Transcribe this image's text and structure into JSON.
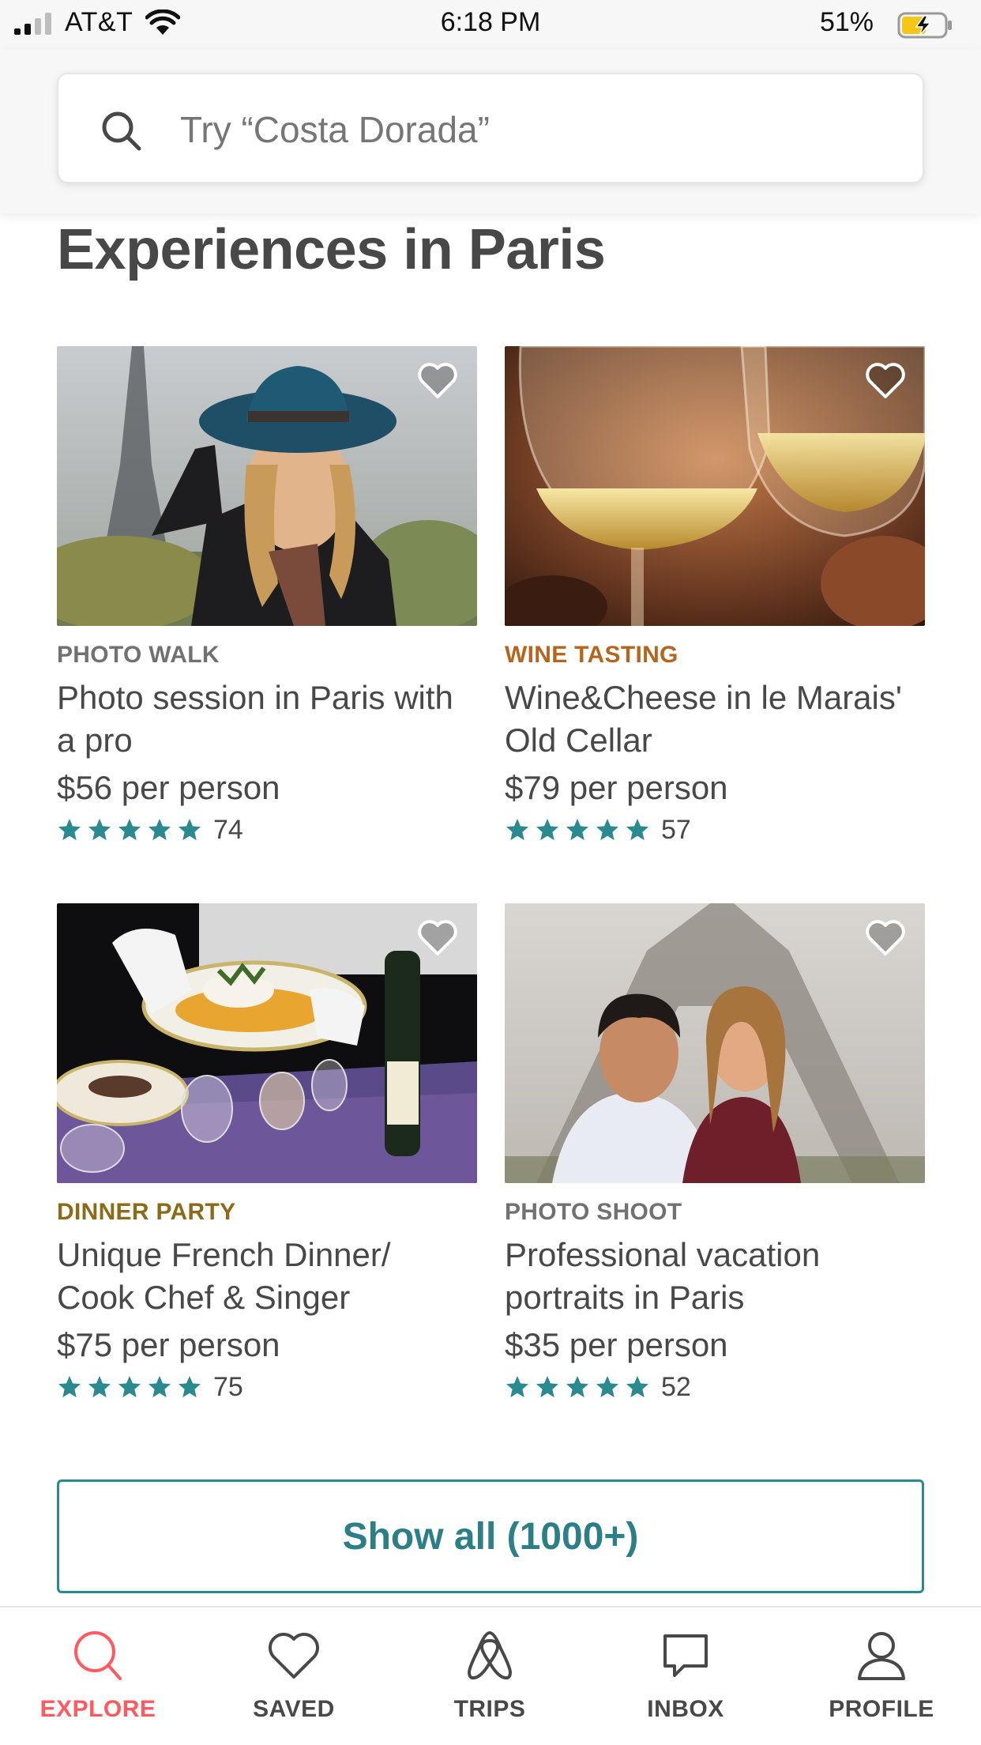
{
  "status_bar": {
    "carrier": "AT&T",
    "time": "6:18 PM",
    "battery": "51%",
    "icons": [
      "signal-icon",
      "wifi-icon",
      "battery-charging-icon"
    ]
  },
  "search": {
    "placeholder": "Try “Costa Dorada”",
    "value": "",
    "icon": "search-icon"
  },
  "section": {
    "title": "Experiences in Paris"
  },
  "cards": [
    {
      "category": "PHOTO WALK",
      "category_color": "#717171",
      "title_line1": "Photo session in Paris with",
      "title_line2": "a pro",
      "price": "$56 per person",
      "reviews": "74",
      "stars": 5,
      "image": "woman-hat-eiffel-tower-photo",
      "favorited": false
    },
    {
      "category": "WINE TASTING",
      "category_color": "#b5651d",
      "title_line1": "Wine&Cheese in le Marais'",
      "title_line2": "Old Cellar",
      "price": "$79 per person",
      "reviews": "57",
      "stars": 5,
      "image": "wine-glasses-toast-photo",
      "favorited": false
    },
    {
      "category": "DINNER PARTY",
      "category_color": "#8b6a1a",
      "title_line1": "Unique French Dinner/",
      "title_line2": "Cook Chef & Singer",
      "price": "$75 per person",
      "reviews": "75",
      "stars": 5,
      "image": "dinner-table-plating-photo",
      "favorited": false
    },
    {
      "category": "PHOTO SHOOT",
      "category_color": "#717171",
      "title_line1": "Professional vacation",
      "title_line2": "portraits in Paris",
      "price": "$35 per person",
      "reviews": "52",
      "stars": 5,
      "image": "couple-eiffel-tower-photo",
      "favorited": false
    }
  ],
  "show_all": {
    "label": "Show all (1000+)"
  },
  "tab_bar": {
    "active": "explore",
    "tabs": [
      {
        "id": "explore",
        "label": "EXPLORE",
        "icon": "explore-search-icon"
      },
      {
        "id": "saved",
        "label": "SAVED",
        "icon": "heart-icon"
      },
      {
        "id": "trips",
        "label": "TRIPS",
        "icon": "airbnb-logo-icon"
      },
      {
        "id": "inbox",
        "label": "INBOX",
        "icon": "chat-bubble-icon"
      },
      {
        "id": "profile",
        "label": "PROFILE",
        "icon": "person-icon"
      }
    ]
  },
  "colors": {
    "accent": "#ff5a5f",
    "teal": "#2b8a8f",
    "star": "#2b8a8f",
    "text": "#484848"
  }
}
